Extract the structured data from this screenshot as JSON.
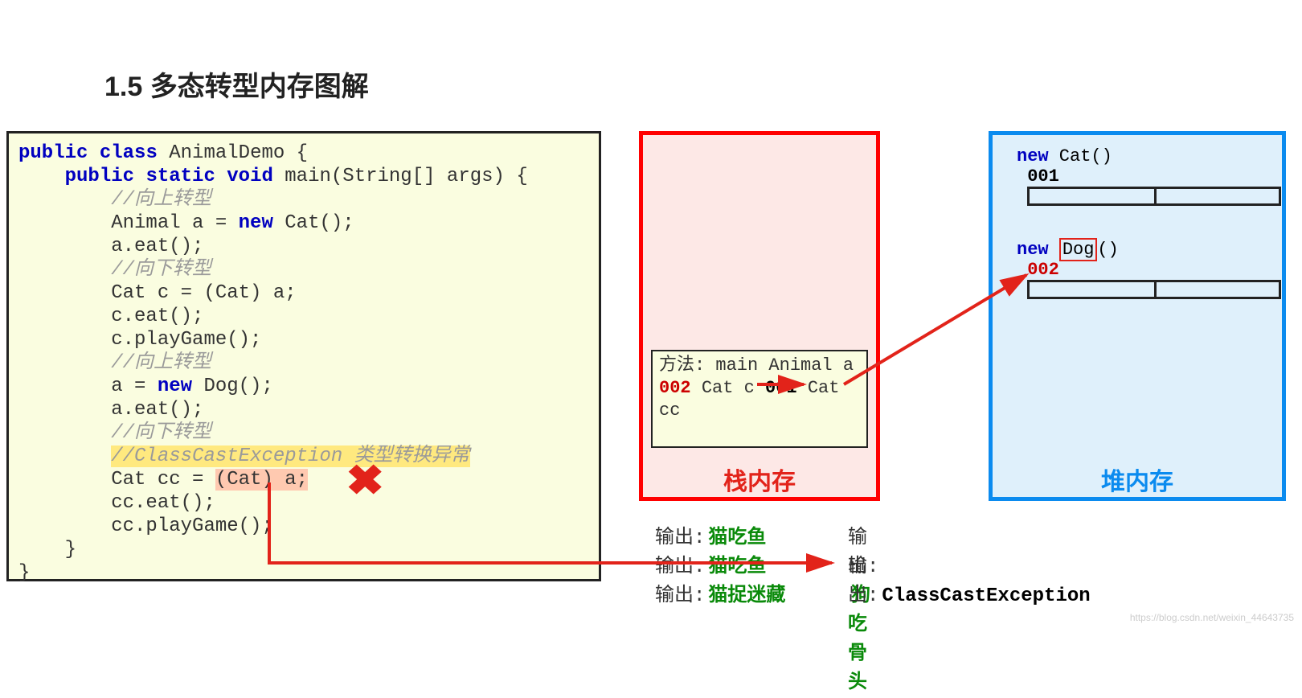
{
  "title": "1.5 多态转型内存图解",
  "code": {
    "l1a": "public",
    "l1b": "class",
    "l1c": " AnimalDemo {",
    "l2a": "public",
    "l2b": "static",
    "l2c": "void",
    "l2d": " main(String[] args) {",
    "c1": "//向上转型",
    "l3a": "        Animal a = ",
    "l3b": "new",
    "l3c": " Cat();",
    "l4": "        a.eat();",
    "c2": "//向下转型",
    "l5": "        Cat c = (Cat) a;",
    "l6": "        c.eat();",
    "l7": "        c.playGame();",
    "c3": "//向上转型",
    "l8a": "        a = ",
    "l8b": "new",
    "l8c": " Dog();",
    "l9": "        a.eat();",
    "c4": "//向下转型",
    "c5": "//ClassCastException 类型转换异常",
    "l10a": "        Cat cc = ",
    "l10b": "(Cat) a;",
    "l11": "        cc.eat();",
    "l12": "        cc.playGame();",
    "l13": "    }",
    "l14": "}"
  },
  "stack": {
    "title": "方法: main",
    "r1a": " Animal a",
    "r1b": "002",
    "r2a": " Cat c",
    "r2b": "001",
    "r3": " Cat cc",
    "label": "栈内存"
  },
  "heap": {
    "cat_new": "new",
    "cat_txt": " Cat()",
    "cat_addr": "001",
    "dog_new": "new",
    "dog_txt": "Dog",
    "dog_paren": "()",
    "dog_addr": "002",
    "label": "堆内存"
  },
  "out": {
    "lab": "输出:",
    "v1": "猫吃鱼",
    "v2": "猫吃鱼",
    "v3": "猫捉迷藏",
    "v4": "狗吃骨头",
    "v5": "ClassCastException"
  },
  "watermark": "https://blog.csdn.net/weixin_44643735"
}
